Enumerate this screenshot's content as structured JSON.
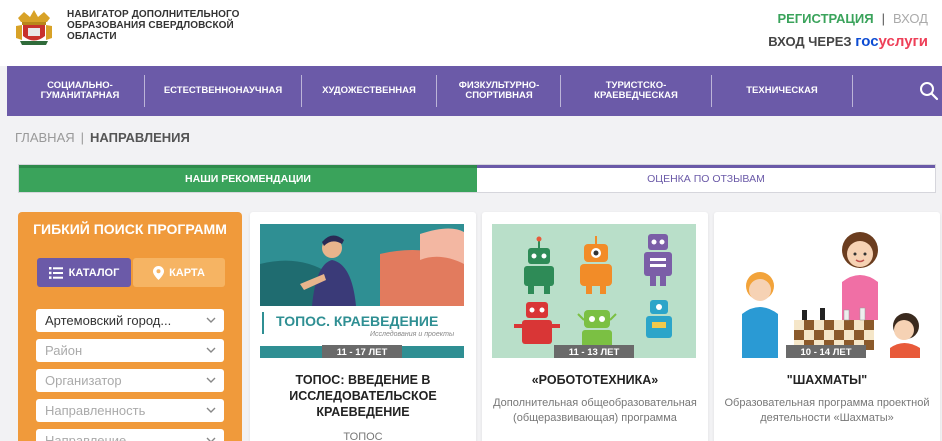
{
  "header": {
    "site_title": "НАВИГАТОР ДОПОЛНИТЕЛЬНОГО ОБРАЗОВАНИЯ СВЕРДЛОВСКОЙ ОБЛАСТИ",
    "register": "РЕГИСТРАЦИЯ",
    "separator": "|",
    "login": "ВХОД",
    "gosuslugi_prefix": "ВХОД ЧЕРЕЗ",
    "gosuslugi_gos": "гос",
    "gosuslugi_uslugi": "услуги"
  },
  "nav": {
    "items": [
      "СОЦИАЛЬНО- ГУМАНИТАРНАЯ",
      "ЕСТЕСТВЕННОНАУЧНАЯ",
      "ХУДОЖЕСТВЕННАЯ",
      "ФИЗКУЛЬТУРНО- СПОРТИВНАЯ",
      "ТУРИСТСКО- КРАЕВЕДЧЕСКАЯ",
      "ТЕХНИЧЕСКАЯ"
    ]
  },
  "breadcrumb": {
    "home": "ГЛАВНАЯ",
    "separator": "|",
    "current": "НАПРАВЛЕНИЯ"
  },
  "tabs": {
    "active": "НАШИ РЕКОМЕНДАЦИИ",
    "inactive": "ОЦЕНКА ПО ОТЗЫВАМ"
  },
  "filter": {
    "title": "ГИБКИЙ ПОИСК ПРОГРАММ",
    "catalog_label": "КАТАЛОГ",
    "map_label": "КАРТА",
    "selects": [
      {
        "value": "Артемовский город...",
        "filled": true
      },
      {
        "value": "Район",
        "filled": false
      },
      {
        "value": "Организатор",
        "filled": false
      },
      {
        "value": "Направленность",
        "filled": false
      },
      {
        "value": "Направление",
        "filled": false
      }
    ]
  },
  "cards": [
    {
      "age": "11 - 17 ЛЕТ",
      "image_caption": "ТОПОС. КРАЕВЕДЕНИЕ",
      "image_subcaption": "Исследования и проекты",
      "title": "ТОПОС: ВВЕДЕНИЕ В ИССЛЕДОВАТЕЛЬСКОЕ КРАЕВЕДЕНИЕ",
      "desc": "ТОПОС"
    },
    {
      "age": "11 - 13 ЛЕТ",
      "title": "«РОБОТОТЕХНИКА»",
      "desc": "Дополнительная общеобразовательная (общеразвивающая) программа"
    },
    {
      "age": "10 - 14 ЛЕТ",
      "title": "\"ШАХМАТЫ\"",
      "desc": "Образовательная программа проектной деятельности «Шахматы»"
    }
  ],
  "colors": {
    "nav_purple": "#6b5aa8",
    "green": "#3aa35b",
    "orange": "#f09a3b"
  }
}
